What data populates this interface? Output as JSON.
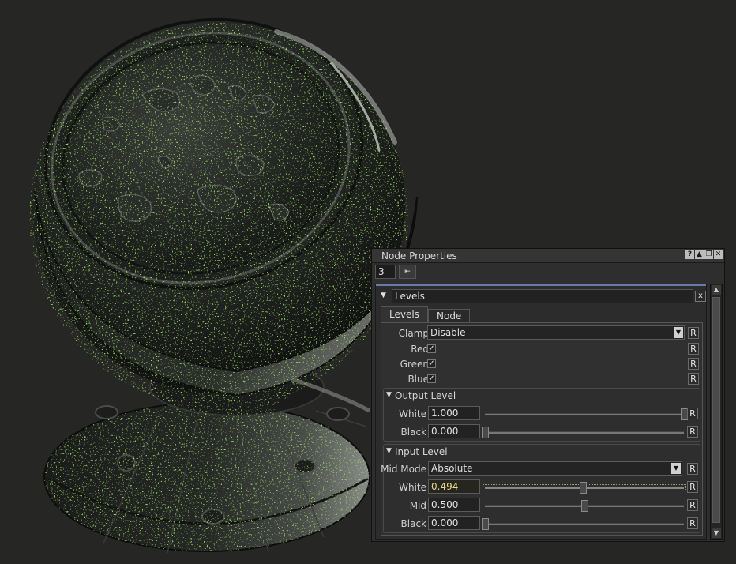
{
  "panel": {
    "title": "Node Properties",
    "title_buttons": [
      "?",
      "▲",
      "❐",
      "✕"
    ],
    "layer_value": "3",
    "toolbar_icon": "collapse-all-icon"
  },
  "node": {
    "name": "Levels",
    "close_label": "x"
  },
  "tabs": [
    {
      "label": "Levels",
      "active": true
    },
    {
      "label": "Node",
      "active": false
    }
  ],
  "reset_label": "R",
  "clamp": {
    "label": "Clamp",
    "value": "Disable"
  },
  "channels": [
    {
      "label": "Red",
      "checked": true
    },
    {
      "label": "Green",
      "checked": true
    },
    {
      "label": "Blue",
      "checked": true
    }
  ],
  "output_level": {
    "title": "Output Level",
    "white": {
      "label": "White",
      "value": "1.000",
      "fraction": 1.0
    },
    "black": {
      "label": "Black",
      "value": "0.000",
      "fraction": 0.0
    }
  },
  "input_level": {
    "title": "Input Level",
    "mid_mode": {
      "label": "Mid Mode",
      "value": "Absolute"
    },
    "white": {
      "label": "White",
      "value": "0.494",
      "fraction": 0.494
    },
    "mid": {
      "label": "Mid",
      "value": "0.500",
      "fraction": 0.5
    },
    "black": {
      "label": "Black",
      "value": "0.000",
      "fraction": 0.0
    }
  },
  "colors": {
    "background": "#262624",
    "panel": "#2e2e2e",
    "accent": "#6a7ba8",
    "speckle_green": "#4caf1e",
    "speckle_yellow": "#c8c020"
  }
}
